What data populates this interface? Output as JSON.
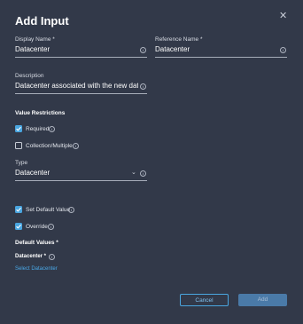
{
  "dialog": {
    "title": "Add Input",
    "close_icon": "close-icon"
  },
  "display_name": {
    "label": "Display Name *",
    "value": "Datacenter"
  },
  "reference_name": {
    "label": "Reference Name *",
    "value": "Datacenter"
  },
  "description": {
    "label": "Description",
    "value": "Datacenter associated with the new datastore"
  },
  "value_restrictions": {
    "title": "Value Restrictions",
    "required": {
      "label": "Required",
      "checked": true
    },
    "collection": {
      "label": "Collection/Multiple",
      "checked": false
    }
  },
  "type": {
    "label": "Type",
    "value": "Datacenter"
  },
  "set_default": {
    "label": "Set Default Value",
    "checked": true
  },
  "override": {
    "label": "Override",
    "checked": true
  },
  "default_values": {
    "title": "Default Values *",
    "datacenter_label": "Datacenter *",
    "select_link": "Select Datacenter"
  },
  "footer": {
    "cancel_label": "Cancel",
    "add_label": "Add"
  },
  "colors": {
    "background": "#323949",
    "accent": "#4aa6e0",
    "disabled_button": "#4a7aa8"
  }
}
